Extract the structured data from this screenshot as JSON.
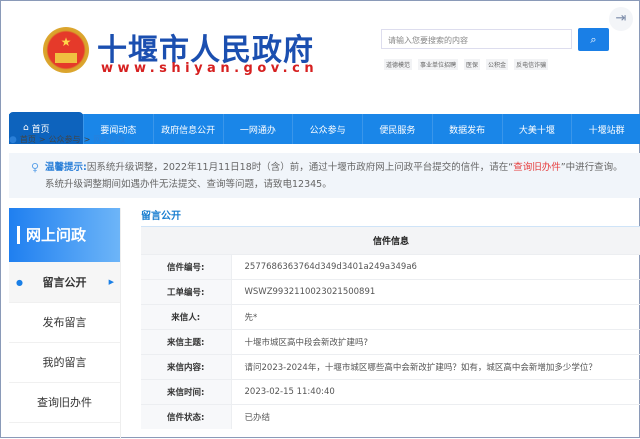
{
  "header": {
    "title": "十堰市人民政府",
    "url": "www.shiyan.gov.cn",
    "search_placeholder": "请输入您要搜索的内容",
    "hot_words": [
      "道德模范",
      "事业单位招聘",
      "医保",
      "公积金",
      "反电信诈骗"
    ]
  },
  "nav": [
    "首页",
    "要闻动态",
    "政府信息公开",
    "一网通办",
    "公众参与",
    "便民服务",
    "数据发布",
    "大美十堰",
    "十堰站群"
  ],
  "breadcrumb": [
    "首页",
    "公众参与",
    "网上问政"
  ],
  "notice": {
    "label": "温馨提示:",
    "text1": "因系统升级调整，2022年11月11日18时（含）前，通过十堰市政府网上问政平台提交的信件，请在“",
    "link": "查询旧办件",
    "text2": "”中进行查询。系统升级调整期间如遇办件无法提交、查询等问题，请致电12345。"
  },
  "sidebar": {
    "title": "网上问政",
    "items": [
      "留言公开",
      "发布留言",
      "我的留言",
      "查询旧办件"
    ]
  },
  "content": {
    "tab": "留言公开",
    "table_title": "信件信息",
    "rows": [
      {
        "label": "信件编号:",
        "value": "2577686363764d349d3401a249a349a6"
      },
      {
        "label": "工单编号:",
        "value": "WSWZ993211002302150089​1"
      },
      {
        "label": "来信人:",
        "value": "先*"
      },
      {
        "label": "来信主题:",
        "value": "十堰市城区高中段会新改扩建吗?"
      },
      {
        "label": "来信内容:",
        "value": "请问2023-2024年，十堰市城区哪些高中会新改扩建吗？如有，城区高中会新增加多少学位？"
      },
      {
        "label": "来信时间:",
        "value": "2023-02-15 11:40:40"
      },
      {
        "label": "信件状态:",
        "value": "已办结"
      }
    ]
  }
}
